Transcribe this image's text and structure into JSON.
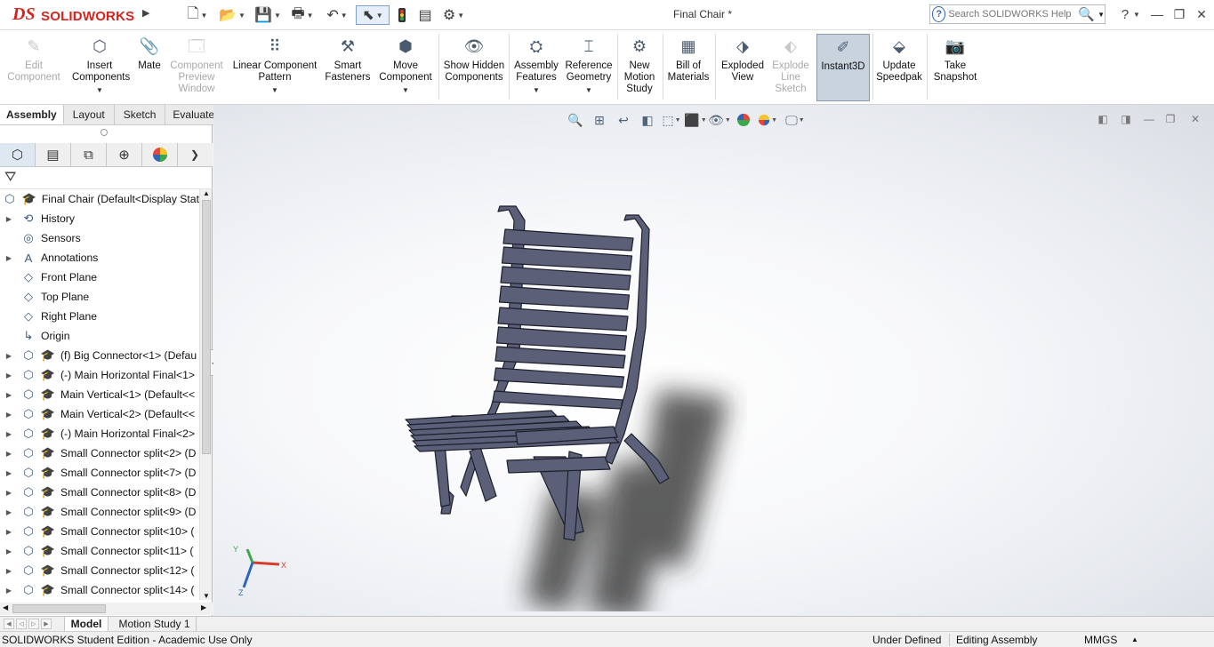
{
  "app": {
    "brand_ds": "DS",
    "brand_name": "SOLIDWORKS",
    "document_title": "Final Chair *"
  },
  "quick_access": [
    "new-document",
    "open",
    "save",
    "print",
    "undo",
    "select",
    "rebuild",
    "file-properties",
    "options"
  ],
  "help": {
    "search_placeholder": "Search SOLIDWORKS Help",
    "help_label": "?"
  },
  "command_manager": {
    "buttons": [
      {
        "id": "edit-component",
        "label": "Edit Component",
        "enabled": false,
        "icon": "edit-component-icon"
      },
      {
        "id": "insert-components",
        "label": "Insert Components",
        "enabled": true,
        "icon": "insert-components-icon",
        "dropdown": true
      },
      {
        "id": "mate",
        "label": "Mate",
        "enabled": true,
        "icon": "paperclip-icon"
      },
      {
        "id": "component-preview-window",
        "label": "Component Preview Window",
        "enabled": false,
        "icon": "preview-window-icon"
      },
      {
        "id": "linear-component-pattern",
        "label": "Linear Component Pattern",
        "enabled": true,
        "icon": "linear-pattern-icon",
        "dropdown": true
      },
      {
        "id": "smart-fasteners",
        "label": "Smart Fasteners",
        "enabled": true,
        "icon": "smart-fasteners-icon"
      },
      {
        "id": "move-component",
        "label": "Move Component",
        "enabled": true,
        "icon": "move-component-icon",
        "dropdown": true
      },
      {
        "id": "show-hidden-components",
        "label": "Show Hidden Components",
        "enabled": true,
        "icon": "show-hidden-icon"
      },
      {
        "id": "assembly-features",
        "label": "Assembly Features",
        "enabled": true,
        "icon": "assembly-features-icon",
        "dropdown": true
      },
      {
        "id": "reference-geometry",
        "label": "Reference Geometry",
        "enabled": true,
        "icon": "reference-geometry-icon",
        "dropdown": true
      },
      {
        "id": "new-motion-study",
        "label": "New Motion Study",
        "enabled": true,
        "icon": "motion-study-icon"
      },
      {
        "id": "bill-of-materials",
        "label": "Bill of Materials",
        "enabled": true,
        "icon": "bom-icon"
      },
      {
        "id": "exploded-view",
        "label": "Exploded View",
        "enabled": true,
        "icon": "exploded-view-icon"
      },
      {
        "id": "explode-line-sketch",
        "label": "Explode Line Sketch",
        "enabled": false,
        "icon": "explode-line-icon"
      },
      {
        "id": "instant3d",
        "label": "Instant3D",
        "enabled": true,
        "active": true,
        "icon": "instant3d-icon"
      },
      {
        "id": "update-speedpak",
        "label": "Update Speedpak",
        "enabled": true,
        "icon": "speedpak-icon"
      },
      {
        "id": "take-snapshot",
        "label": "Take Snapshot",
        "enabled": true,
        "icon": "camera-icon"
      }
    ]
  },
  "cm_tabs": [
    "Assembly",
    "Layout",
    "Sketch",
    "Evaluate"
  ],
  "manager_tabs": [
    "featuremanager",
    "propertymanager",
    "configurationmanager",
    "dimxpertmanager",
    "displaymanager"
  ],
  "feature_tree": {
    "root": "Final Chair  (Default<Display Stat",
    "items": [
      {
        "label": "History",
        "expandable": true,
        "icon": "history-icon"
      },
      {
        "label": "Sensors",
        "expandable": false,
        "icon": "sensors-icon"
      },
      {
        "label": "Annotations",
        "expandable": true,
        "icon": "annotations-icon"
      },
      {
        "label": "Front Plane",
        "expandable": false,
        "icon": "plane-icon"
      },
      {
        "label": "Top Plane",
        "expandable": false,
        "icon": "plane-icon"
      },
      {
        "label": "Right Plane",
        "expandable": false,
        "icon": "plane-icon"
      },
      {
        "label": "Origin",
        "expandable": false,
        "icon": "origin-icon"
      },
      {
        "label": "(f) Big Connector<1> (Defau",
        "expandable": true,
        "icon": "part-icon"
      },
      {
        "label": "(-) Main Horizontal Final<1>",
        "expandable": true,
        "icon": "part-icon"
      },
      {
        "label": "Main Vertical<1> (Default<<",
        "expandable": true,
        "icon": "part-icon"
      },
      {
        "label": "Main Vertical<2> (Default<<",
        "expandable": true,
        "icon": "part-icon"
      },
      {
        "label": "(-) Main Horizontal Final<2>",
        "expandable": true,
        "icon": "part-icon"
      },
      {
        "label": "Small Connector split<2> (D",
        "expandable": true,
        "icon": "part-icon"
      },
      {
        "label": "Small Connector split<7> (D",
        "expandable": true,
        "icon": "part-icon"
      },
      {
        "label": "Small Connector split<8> (D",
        "expandable": true,
        "icon": "part-icon"
      },
      {
        "label": "Small Connector split<9> (D",
        "expandable": true,
        "icon": "part-icon"
      },
      {
        "label": "Small Connector split<10> (",
        "expandable": true,
        "icon": "part-icon"
      },
      {
        "label": "Small Connector split<11> (",
        "expandable": true,
        "icon": "part-icon"
      },
      {
        "label": "Small Connector split<12> (",
        "expandable": true,
        "icon": "part-icon"
      },
      {
        "label": "Small Connector split<14> (",
        "expandable": true,
        "icon": "part-icon"
      }
    ]
  },
  "triad": {
    "x": "X",
    "y": "Y",
    "z": "Z"
  },
  "bottom_tabs": [
    "Model",
    "Motion Study 1"
  ],
  "status": {
    "edition": "SOLIDWORKS Student Edition - Academic Use Only",
    "definition": "Under Defined",
    "mode": "Editing Assembly",
    "units": "MMGS"
  },
  "colors": {
    "brand": "#d7231e",
    "chair": "#5b5f77",
    "chair_edge": "#1d1f2c"
  }
}
